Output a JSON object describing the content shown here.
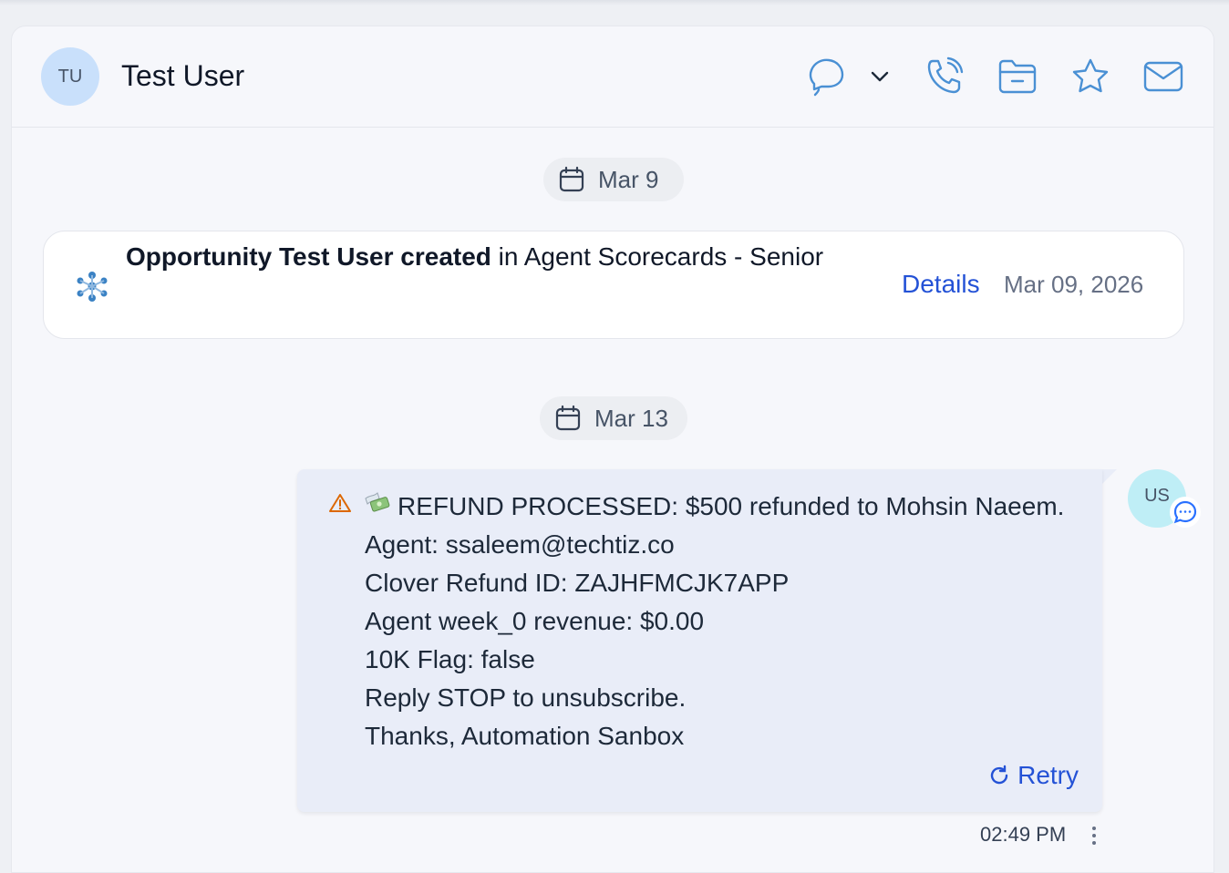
{
  "contact": {
    "initials": "TU",
    "name": "Test User"
  },
  "header_actions": [
    {
      "icon": "chat-icon"
    },
    {
      "icon": "chevron-down-icon"
    },
    {
      "icon": "phone-icon"
    },
    {
      "icon": "folder-icon"
    },
    {
      "icon": "star-icon"
    },
    {
      "icon": "mail-icon"
    }
  ],
  "dates": {
    "first": "Mar 9",
    "second": "Mar 13"
  },
  "activity": {
    "title_bold": "Opportunity Test User created",
    "title_rest": " in Agent Scorecards - Senior",
    "details_label": "Details",
    "date": "Mar 09, 2026",
    "icon": "pipeline-icon"
  },
  "message": {
    "lines": [
      "REFUND PROCESSED: $500 refunded to Mohsin Naeem.",
      "Agent: ssaleem@techtiz.co",
      "Clover Refund ID: ZAJHFMCJK7APP",
      "Agent week_0 revenue: $0.00",
      "10K Flag: false",
      "Reply STOP to unsubscribe.",
      "Thanks, Automation Sanbox"
    ],
    "retry_label": "Retry",
    "sender_initials": "US",
    "time": "02:49 PM",
    "status": "failed"
  },
  "colors": {
    "accent": "#2452d6",
    "icon_blue": "#4a90d4",
    "bubble": "#e9edf8",
    "warning": "#dc6803"
  }
}
